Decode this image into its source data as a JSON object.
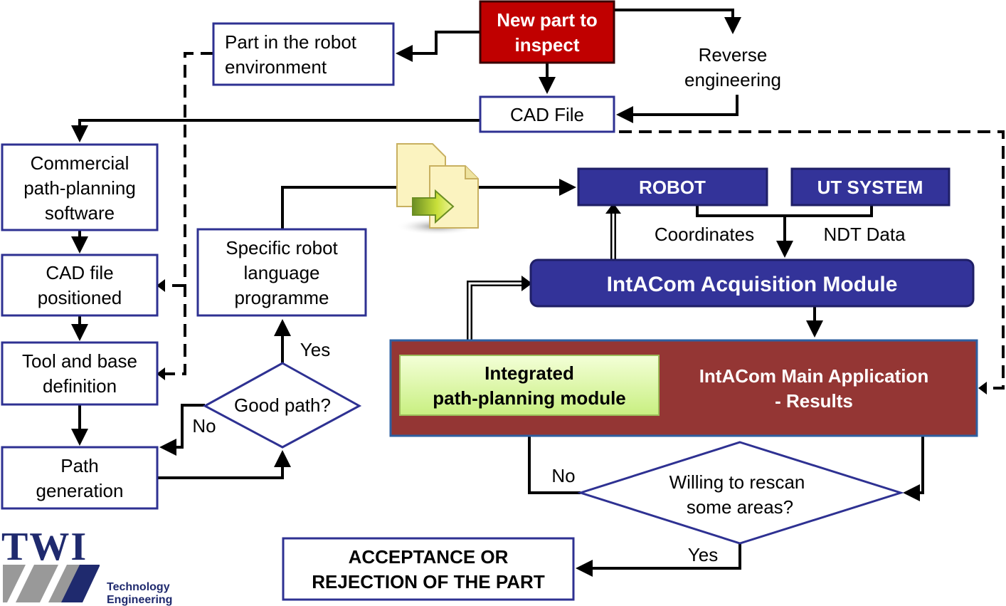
{
  "nodes": {
    "new_part": [
      "New part to",
      "inspect"
    ],
    "part_env": [
      "Part in the robot",
      "environment"
    ],
    "reverse": [
      "Reverse",
      "engineering"
    ],
    "cad_file": "CAD File",
    "commercial": [
      "Commercial",
      "path-planning",
      "software"
    ],
    "cad_positioned": [
      "CAD file",
      "positioned"
    ],
    "tool_base": [
      "Tool and base",
      "definition"
    ],
    "path_gen": [
      "Path",
      "generation"
    ],
    "specific": [
      "Specific robot",
      "language",
      "programme"
    ],
    "good_path": "Good path?",
    "robot": "ROBOT",
    "ut_system": "UT SYSTEM",
    "coordinates": "Coordinates",
    "ndt_data": "NDT Data",
    "acquisition": "IntACom  Acquisition  Module",
    "main_app": [
      "IntACom Main Application",
      "- Results"
    ],
    "integrated": [
      "Integrated",
      "path-planning module"
    ],
    "willing": [
      "Willing to rescan",
      "some areas?"
    ],
    "acceptance": [
      "ACCEPTANCE  OR",
      "REJECTION OF THE PART"
    ]
  },
  "labels": {
    "yes": "Yes",
    "no": "No"
  },
  "logo": {
    "name": "TWI",
    "tagline": [
      "Technology",
      "Engineering"
    ]
  },
  "icons": {
    "file_transfer": "file-transfer-icon"
  },
  "colors": {
    "red": "#c00000",
    "navy": "#333399",
    "maroon": "#943634",
    "green": "#d8f5a0",
    "border": "#2e3192"
  }
}
